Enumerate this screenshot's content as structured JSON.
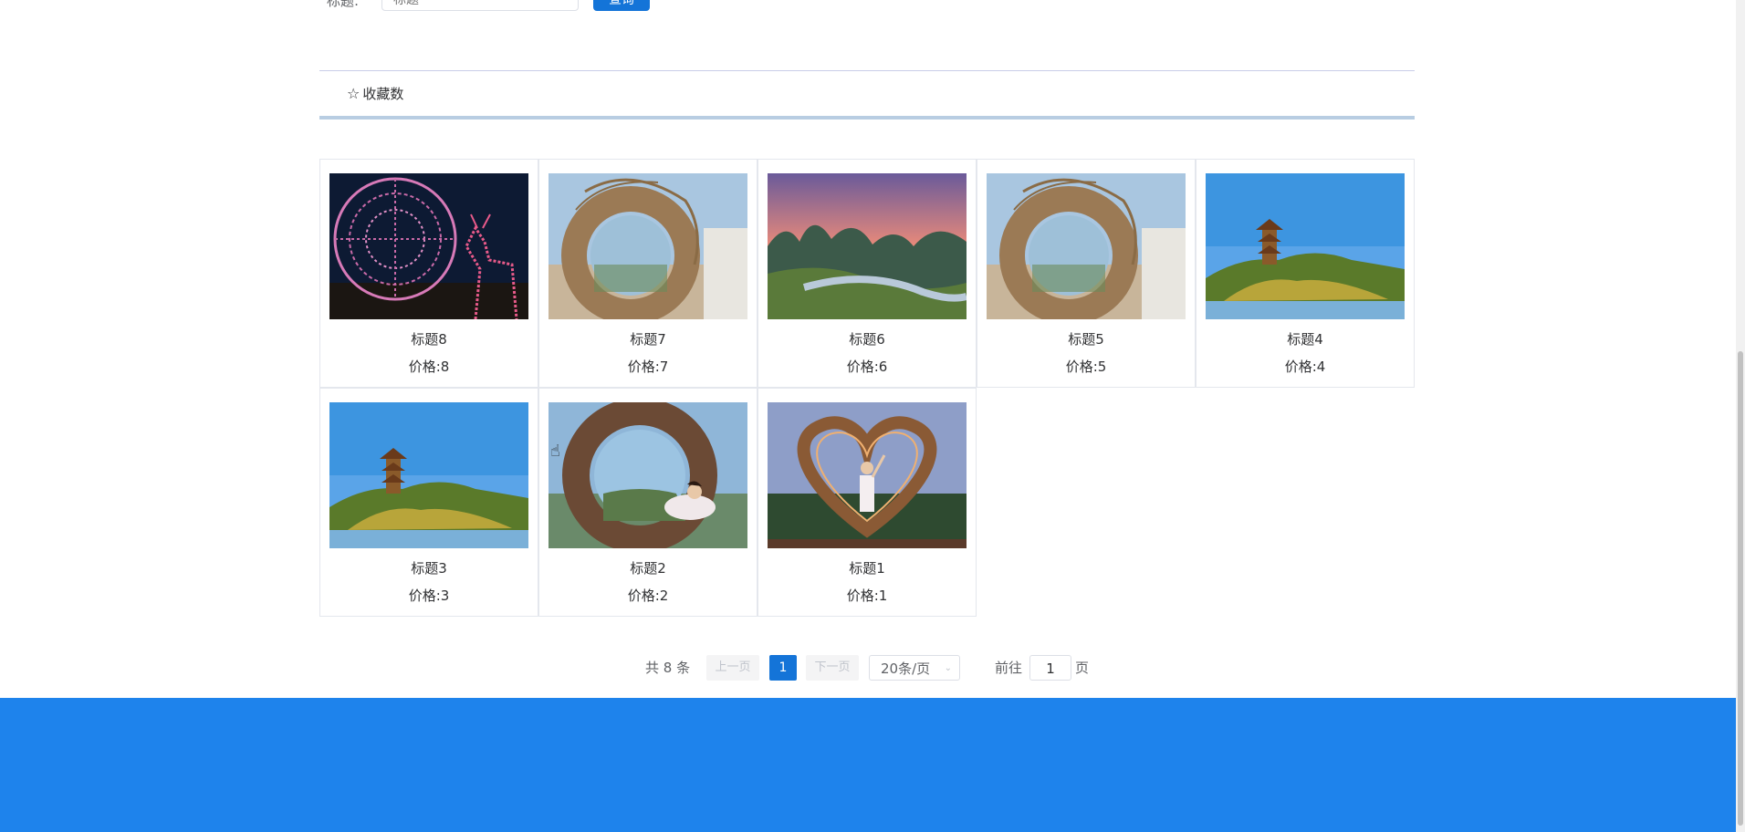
{
  "search": {
    "label": "标题:",
    "placeholder": "标题",
    "button": "查询"
  },
  "sort": {
    "item_label": "收藏数",
    "icon": "star-outline-icon"
  },
  "products": [
    {
      "title": "标题8",
      "price": "价格:8",
      "image": "lantern-sphere-deer"
    },
    {
      "title": "标题7",
      "price": "价格:7",
      "image": "straw-ring-nest"
    },
    {
      "title": "标题6",
      "price": "价格:6",
      "image": "karst-river-sunset"
    },
    {
      "title": "标题5",
      "price": "价格:5",
      "image": "straw-ring-nest"
    },
    {
      "title": "标题4",
      "price": "价格:4",
      "image": "pagoda-lake"
    },
    {
      "title": "标题3",
      "price": "价格:3",
      "image": "pagoda-lake"
    },
    {
      "title": "标题2",
      "price": "价格:2",
      "image": "woman-in-twig-ring"
    },
    {
      "title": "标题1",
      "price": "价格:1",
      "image": "woman-in-heart-frame"
    }
  ],
  "pagination": {
    "total": "共 8 条",
    "prev": "上一页",
    "current": "1",
    "next": "下一页",
    "page_size": "20条/页",
    "goto_prefix": "前往",
    "goto_value": "1",
    "goto_suffix": "页"
  },
  "colors": {
    "primary": "#1474d8",
    "footer": "#1e83ec"
  }
}
